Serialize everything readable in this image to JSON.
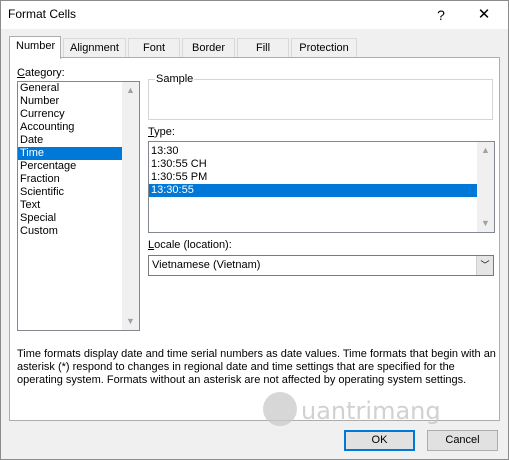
{
  "window": {
    "title": "Format Cells",
    "help_glyph": "?",
    "close_glyph": "✕"
  },
  "tabs": [
    {
      "label": "Number",
      "active": true
    },
    {
      "label": "Alignment",
      "active": false
    },
    {
      "label": "Font",
      "active": false
    },
    {
      "label": "Border",
      "active": false
    },
    {
      "label": "Fill",
      "active": false
    },
    {
      "label": "Protection",
      "active": false
    }
  ],
  "category": {
    "label_hotkey": "C",
    "label_rest": "ategory:",
    "items": [
      "General",
      "Number",
      "Currency",
      "Accounting",
      "Date",
      "Time",
      "Percentage",
      "Fraction",
      "Scientific",
      "Text",
      "Special",
      "Custom"
    ],
    "selected": "Time"
  },
  "sample": {
    "label": "Sample",
    "value": ""
  },
  "type": {
    "label_hotkey": "T",
    "label_rest": "ype:",
    "items": [
      "13:30",
      "1:30:55 CH",
      "1:30:55 PM",
      "13:30:55"
    ],
    "selected": "13:30:55"
  },
  "locale": {
    "label_hotkey": "L",
    "label_rest": "ocale (location):",
    "value": "Vietnamese (Vietnam)"
  },
  "description": "Time formats display date and time serial numbers as date values.  Time formats that begin with an asterisk (*) respond to changes in regional date and time settings that are specified for the operating system. Formats without an asterisk are not affected by operating system settings.",
  "buttons": {
    "ok": "OK",
    "cancel": "Cancel"
  },
  "icons": {
    "scroll_up": "▲",
    "scroll_down": "▼",
    "dropdown": "﹀"
  },
  "watermark": {
    "text": "uantrimang"
  },
  "colors": {
    "selection": "#0078d7",
    "dialog_bg": "#f0f0f0"
  }
}
